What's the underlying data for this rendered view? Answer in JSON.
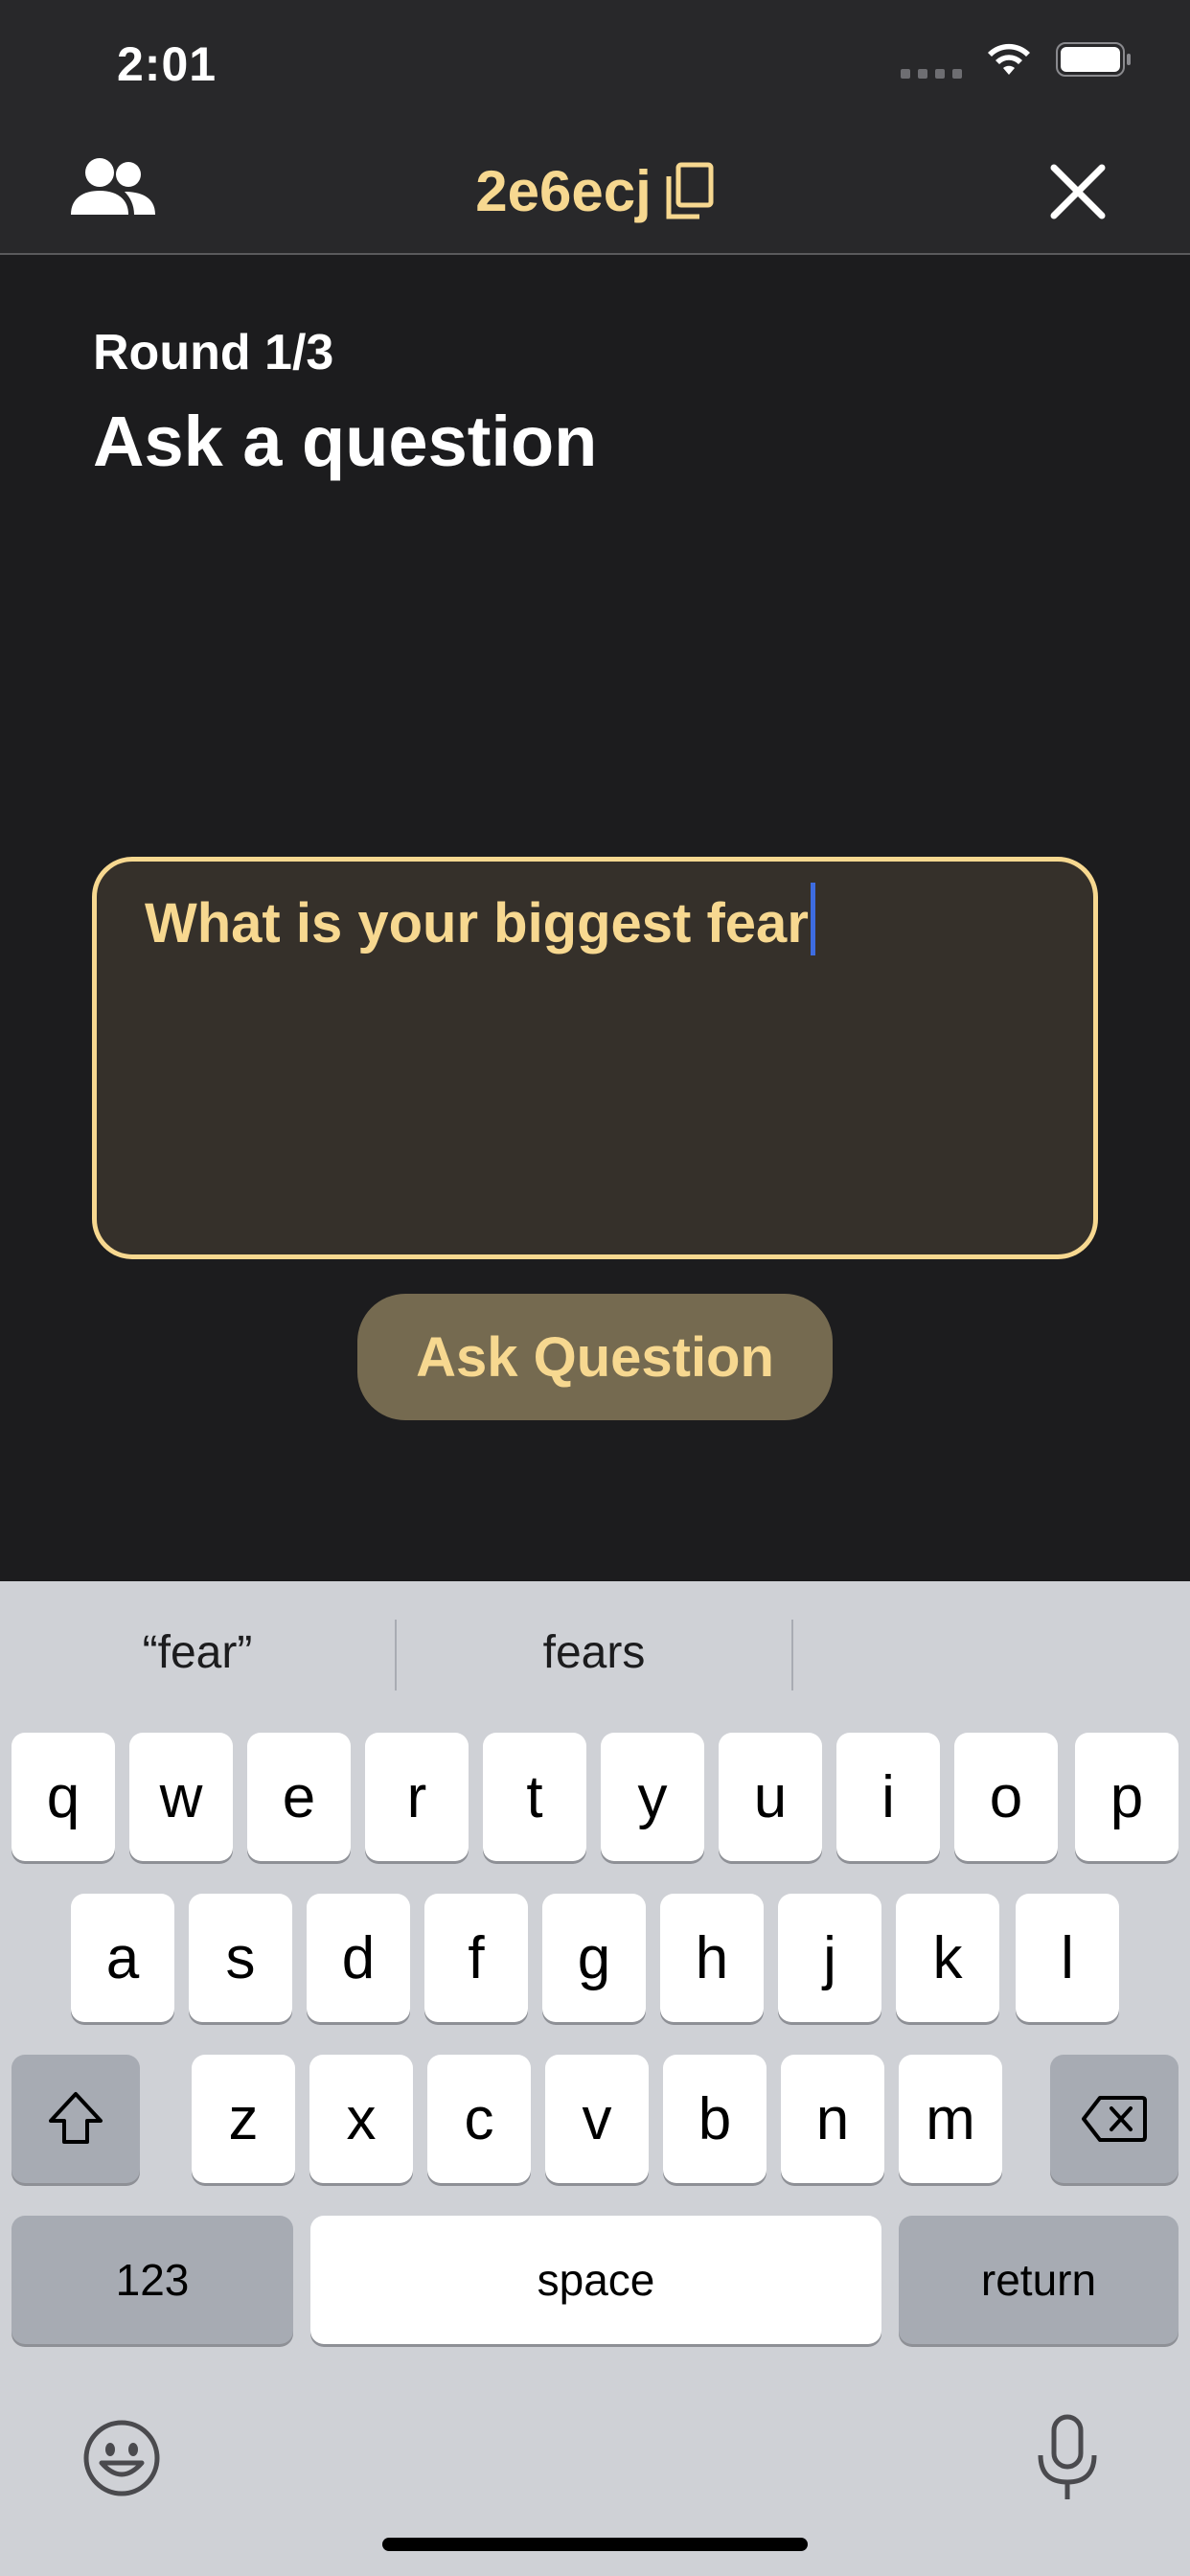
{
  "status_bar": {
    "time": "2:01"
  },
  "header": {
    "room_code": "2e6ecj"
  },
  "round": {
    "label": "Round 1/3",
    "title": "Ask a question"
  },
  "question_input": {
    "value": "What is your biggest fear"
  },
  "ask_button": {
    "label": "Ask Question"
  },
  "keyboard": {
    "predictions": [
      "“fear”",
      "fears",
      ""
    ],
    "row1": [
      "q",
      "w",
      "e",
      "r",
      "t",
      "y",
      "u",
      "i",
      "o",
      "p"
    ],
    "row2": [
      "a",
      "s",
      "d",
      "f",
      "g",
      "h",
      "j",
      "k",
      "l"
    ],
    "row3": [
      "z",
      "x",
      "c",
      "v",
      "b",
      "n",
      "m"
    ],
    "numbers_label": "123",
    "space_label": "space",
    "return_label": "return"
  },
  "colors": {
    "accent": "#f7d890",
    "background": "#1c1c1e",
    "button": "#756a50"
  }
}
